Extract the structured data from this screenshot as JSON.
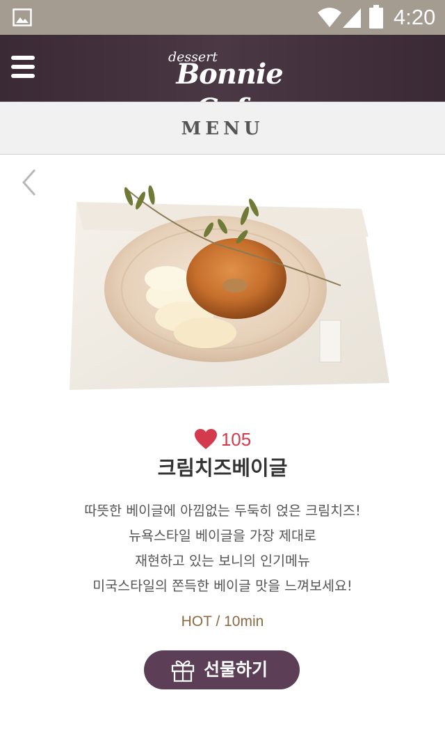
{
  "status_bar": {
    "time": "4:20",
    "icons": [
      "gallery-icon",
      "wifi-icon",
      "signal-icon",
      "battery-icon"
    ]
  },
  "header": {
    "logo_small": "dessert",
    "logo_main": "Bonnie Cafe",
    "menu_icon": "hamburger-icon"
  },
  "menu_bar": {
    "title": "MENU"
  },
  "product": {
    "likes": "105",
    "name": "크림치즈베이글",
    "description": [
      "따뜻한 베이글에 아낌없는 두둑히 얹은 크림치즈!",
      "뉴욕스타일 베이글을 가장 제대로",
      "재현하고 있는 보니의 인기메뉴",
      "미국스타일의 쫀득한 베이글 맛을 느껴보세요!"
    ],
    "meta": "HOT / 10min"
  },
  "gift_button": {
    "label": "선물하기",
    "icon": "gift-icon"
  },
  "colors": {
    "status_bar": "#a49b91",
    "header": "#3a2a36",
    "heart": "#d43a4e",
    "gift_button": "#5c3f56",
    "meta_text": "#8a6a42"
  }
}
